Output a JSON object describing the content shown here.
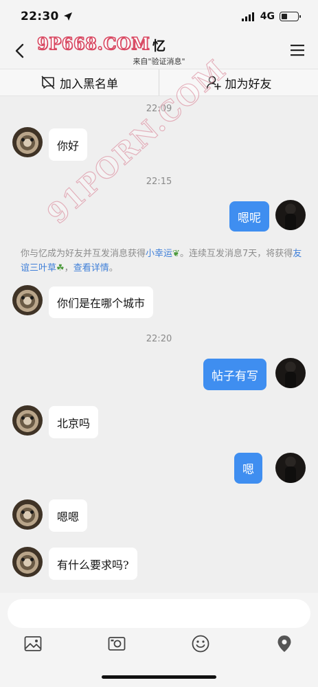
{
  "status_bar": {
    "time": "22:30",
    "network": "4G",
    "battery_level": 0.35
  },
  "nav": {
    "title": "忆",
    "subtitle": "来自\"验证消息\"",
    "watermark": "9P668.COM"
  },
  "actions": {
    "blacklist_label": "加入黑名单",
    "add_friend_label": "加为好友"
  },
  "watermark_diagonal": "91PORN.COM",
  "messages": {
    "t1": "22:09",
    "m1": "你好",
    "t2": "22:15",
    "m2": "嗯呢",
    "notice_a": "你与忆成为好友并互发消息获得",
    "notice_link1": "小幸运",
    "notice_b": "。连续互发消息7天，将获得",
    "notice_link2": "友谊三叶草",
    "notice_c": "，",
    "notice_link3": "查看详情",
    "notice_d": "。",
    "m3": "你们是在哪个城市",
    "t3": "22:20",
    "m4": "帖子有写",
    "m5": "北京吗",
    "m6": "嗯",
    "m7": "嗯嗯",
    "m8": "有什么要求吗?"
  },
  "input": {
    "value": "",
    "placeholder": ""
  },
  "icons": [
    "back-icon",
    "menu-icon",
    "block-icon",
    "add-friend-icon",
    "image-icon",
    "camera-icon",
    "emoji-icon",
    "location-icon"
  ]
}
